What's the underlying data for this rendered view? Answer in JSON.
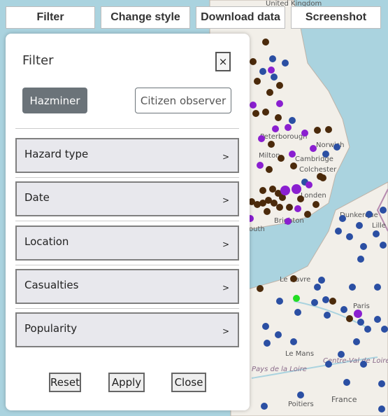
{
  "toolbar": {
    "filter": "Filter",
    "change_style": "Change style",
    "download_data": "Download data",
    "screenshot": "Screenshot"
  },
  "panel": {
    "title": "Filter",
    "close_symbol": "×",
    "sources": [
      "Hazminer",
      "Citizen observer"
    ],
    "active_source": "Hazminer",
    "sections": [
      "Hazard type",
      "Date",
      "Location",
      "Casualties",
      "Popularity"
    ],
    "chevron": ">",
    "buttons": {
      "reset": "Reset",
      "apply": "Apply",
      "close": "Close"
    }
  },
  "map": {
    "labels": [
      "United Kingdom",
      "Peterborough",
      "Norwich",
      "Milton",
      "Cambridge",
      "Colchester",
      "Dunkerque",
      "Brighton",
      "outh",
      "Le Havre",
      "Paris",
      "Le Mans",
      "Centre-Val de Loire",
      "Pays de la Loire",
      "Poitiers",
      "France",
      "Lille",
      "Londen"
    ],
    "colors": {
      "water": "#aad3df",
      "land": "#f2efe9",
      "hazminer": "#4b2a0b",
      "citizen": "#2b4fa3",
      "highlight": "#8a1fd0",
      "new": "#22dd22"
    }
  }
}
